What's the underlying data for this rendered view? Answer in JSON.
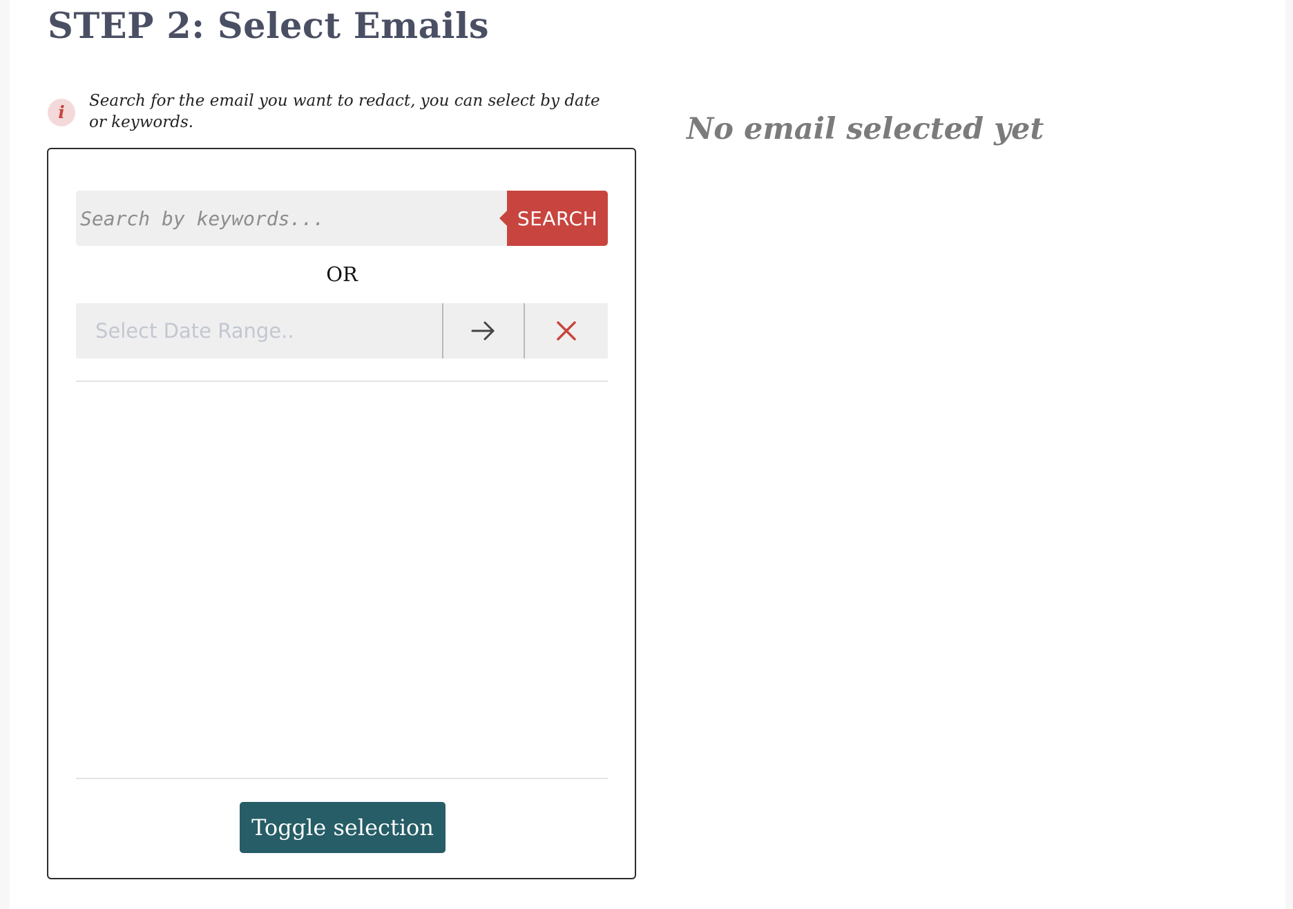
{
  "header": {
    "title": "STEP 2: Select Emails"
  },
  "info": {
    "icon": "info-icon",
    "icon_glyph": "i",
    "text": "Search for the email you want to redact, you can select by date or keywords."
  },
  "status": {
    "text": "No email selected yet"
  },
  "search": {
    "placeholder": "Search by keywords...",
    "value": "",
    "button_label": "SEARCH"
  },
  "separator": {
    "label": "OR"
  },
  "date_range": {
    "placeholder": "Select Date Range..",
    "value": "",
    "go_icon": "arrow-right-icon",
    "clear_icon": "close-icon"
  },
  "results": {
    "items": []
  },
  "footer": {
    "toggle_label": "Toggle selection"
  },
  "colors": {
    "accent_red": "#c8453f",
    "button_teal": "#265d66",
    "title_slate": "#4a4f63",
    "status_gray": "#7b7b7b",
    "input_bg": "#efefef"
  }
}
